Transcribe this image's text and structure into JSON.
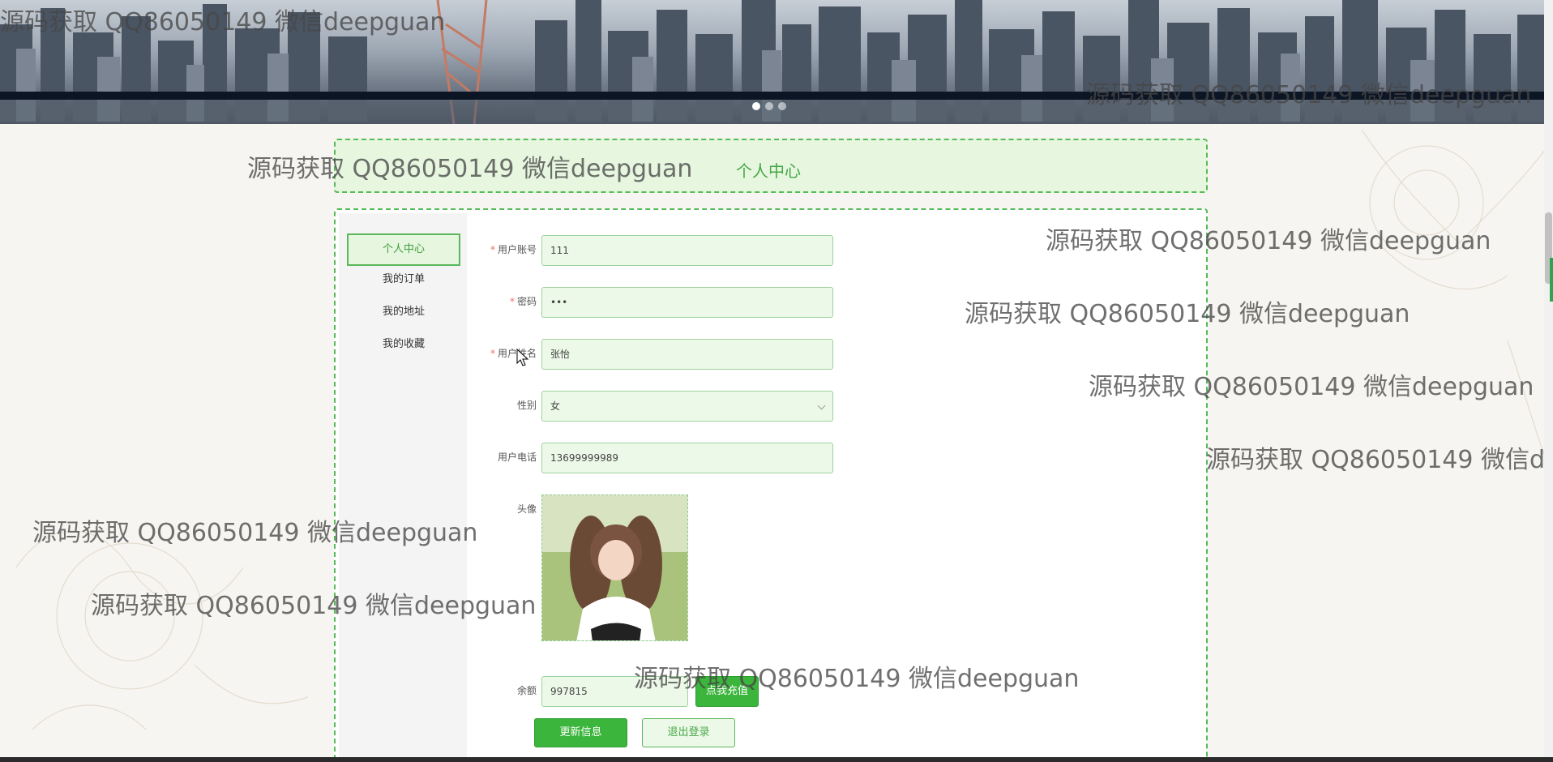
{
  "banner": {
    "slides": 3,
    "active_slide": 1
  },
  "header": {
    "title": "个人中心"
  },
  "sidebar": {
    "items": [
      {
        "label": "个人中心",
        "active": true
      },
      {
        "label": "我的订单",
        "active": false
      },
      {
        "label": "我的地址",
        "active": false
      },
      {
        "label": "我的收藏",
        "active": false
      }
    ]
  },
  "form": {
    "account": {
      "label": "用户账号",
      "value": "111",
      "required": true
    },
    "password": {
      "label": "密码",
      "value": "•••",
      "required": true
    },
    "name": {
      "label": "用户姓名",
      "value": "张怡",
      "required": true
    },
    "gender": {
      "label": "性别",
      "value": "女",
      "required": false
    },
    "phone": {
      "label": "用户电话",
      "value": "13699999989",
      "required": false
    },
    "avatar": {
      "label": "头像"
    },
    "balance": {
      "label": "余额",
      "value": "997815",
      "recharge_label": "点我充值"
    }
  },
  "actions": {
    "update_label": "更新信息",
    "logout_label": "退出登录"
  },
  "watermark": {
    "text": "源码获取 QQ86050149 微信deepguan"
  },
  "colors": {
    "accent": "#3cb53c",
    "panel_border": "#57b957",
    "field_bg": "#edf9e8",
    "required": "#f56c6c"
  }
}
